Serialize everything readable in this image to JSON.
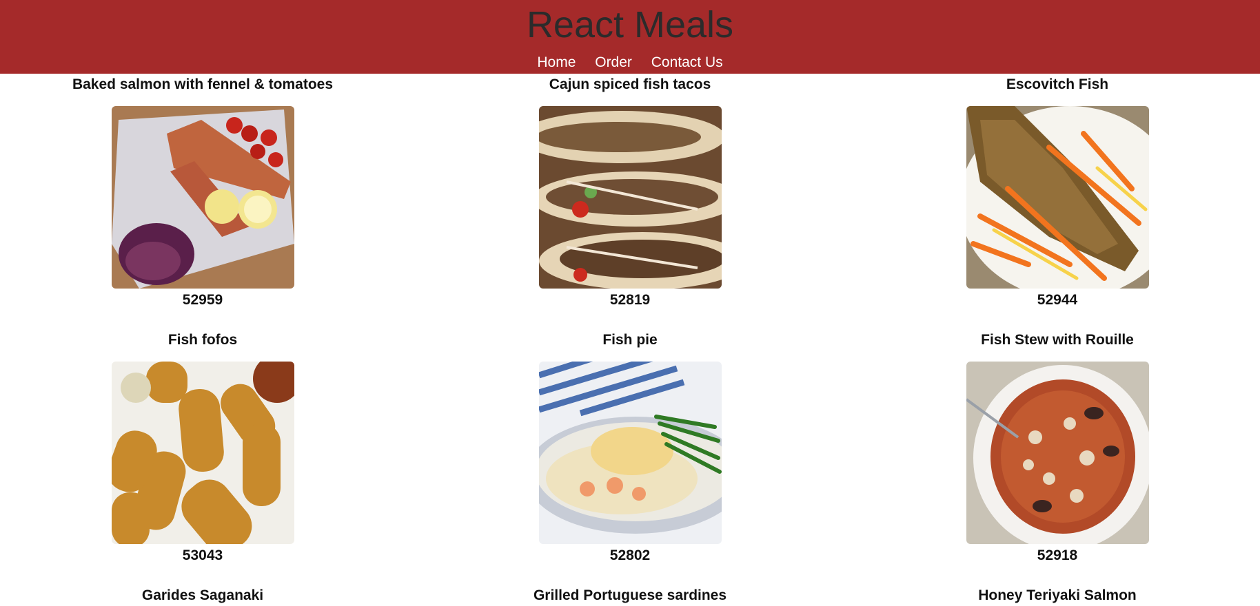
{
  "header": {
    "title": "React Meals",
    "nav": [
      "Home",
      "Order",
      "Contact Us"
    ]
  },
  "colors": {
    "header_bg": "#a52a2a",
    "title": "#2b2b2b",
    "nav_text": "#ffffff"
  },
  "meals": [
    {
      "name": "Baked salmon with fennel & tomatoes",
      "id": "52959"
    },
    {
      "name": "Cajun spiced fish tacos",
      "id": "52819"
    },
    {
      "name": "Escovitch Fish",
      "id": "52944"
    },
    {
      "name": "Fish fofos",
      "id": "53043"
    },
    {
      "name": "Fish pie",
      "id": "52802"
    },
    {
      "name": "Fish Stew with Rouille",
      "id": "52918"
    },
    {
      "name": "Garides Saganaki",
      "id": ""
    },
    {
      "name": "Grilled Portuguese sardines",
      "id": ""
    },
    {
      "name": "Honey Teriyaki Salmon",
      "id": ""
    }
  ]
}
